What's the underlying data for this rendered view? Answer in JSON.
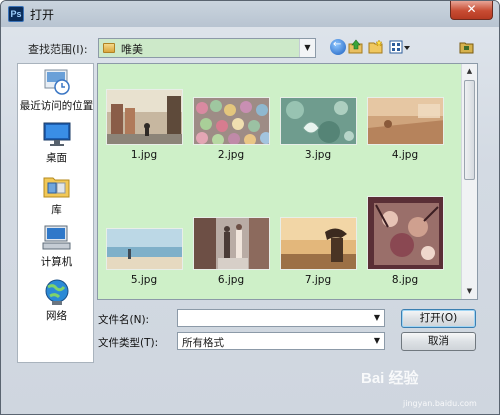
{
  "window": {
    "title": "打开",
    "app_icon_text": "Ps",
    "close_glyph": "✕"
  },
  "toolbar": {
    "lookin_label": "查找范围(I):",
    "lookin_value": "唯美",
    "icons": [
      "back-icon",
      "up-folder-icon",
      "new-folder-icon",
      "view-menu-icon",
      "desktop-icon"
    ]
  },
  "places": [
    {
      "label": "最近访问的位置",
      "icon": "recent-places-icon"
    },
    {
      "label": "桌面",
      "icon": "desktop-icon"
    },
    {
      "label": "库",
      "icon": "libraries-icon"
    },
    {
      "label": "计算机",
      "icon": "computer-icon"
    },
    {
      "label": "网络",
      "icon": "network-icon"
    }
  ],
  "files": [
    {
      "name": "1.jpg"
    },
    {
      "name": "2.jpg"
    },
    {
      "name": "3.jpg"
    },
    {
      "name": "4.jpg"
    },
    {
      "name": "5.jpg"
    },
    {
      "name": "6.jpg"
    },
    {
      "name": "7.jpg"
    },
    {
      "name": "8.jpg"
    }
  ],
  "filename": {
    "label": "文件名(N):",
    "value": ""
  },
  "filetype": {
    "label": "文件类型(T):",
    "value": "所有格式"
  },
  "buttons": {
    "open": "打开(O)",
    "cancel": "取消"
  },
  "watermark": {
    "text": "Bai 经验",
    "sub": "jingyan.baidu.com"
  },
  "colors": {
    "list_background": "#cef0c8",
    "accent": "#3c7fb1"
  }
}
